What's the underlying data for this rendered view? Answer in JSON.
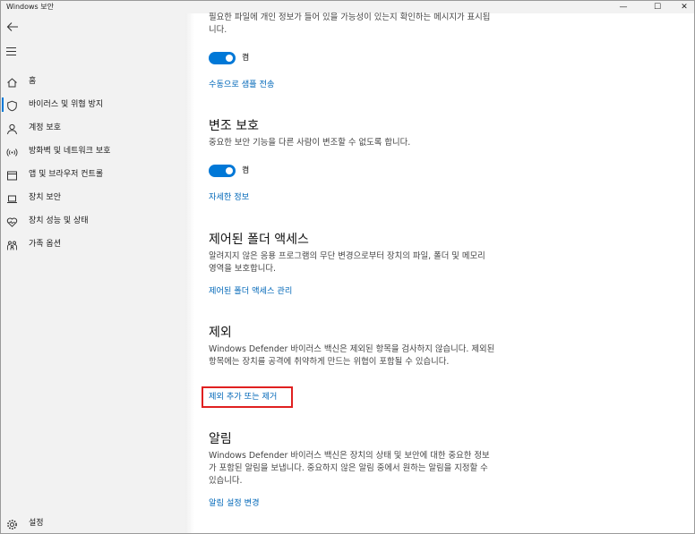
{
  "window": {
    "title": "Windows 보안",
    "min_glyph": "—",
    "max_glyph": "☐",
    "close_glyph": "✕"
  },
  "sidebar": {
    "back_icon": "back-arrow-icon",
    "menu_icon": "hamburger-menu-icon",
    "items": [
      {
        "label": "홈",
        "icon": "home-icon",
        "active": false
      },
      {
        "label": "바이러스 및 위협 방지",
        "icon": "shield-icon",
        "active": true
      },
      {
        "label": "계정 보호",
        "icon": "person-icon",
        "active": false
      },
      {
        "label": "방화벽 및 네트워크 보호",
        "icon": "wifi-icon",
        "active": false
      },
      {
        "label": "앱 및 브라우저 컨트롤",
        "icon": "app-window-icon",
        "active": false
      },
      {
        "label": "장치 보안",
        "icon": "laptop-icon",
        "active": false
      },
      {
        "label": "장치 성능 및 상태",
        "icon": "heart-icon",
        "active": false
      },
      {
        "label": "가족 옵션",
        "icon": "family-icon",
        "active": false
      }
    ],
    "settings": {
      "label": "설정",
      "icon": "gear-icon"
    }
  },
  "main": {
    "cloud_sample": {
      "desc": "필요한 파일에 개인 정보가 들어 있을 가능성이 있는지 확인하는 메시지가 표시됩니다.",
      "toggle_state": "켬",
      "link": "수동으로 샘플 전송"
    },
    "tamper": {
      "heading": "변조 보호",
      "desc": "중요한 보안 기능을 다른 사람이 변조할 수 없도록 합니다.",
      "toggle_state": "켬",
      "link": "자세한 정보"
    },
    "controlled_folder": {
      "heading": "제어된 폴더 액세스",
      "desc": "알려지지 않은 응용 프로그램의 무단 변경으로부터 장치의 파일, 폴더 및 메모리 영역을 보호합니다.",
      "link": "제어된 폴더 액세스 관리"
    },
    "exclusions": {
      "heading": "제외",
      "desc": "Windows Defender 바이러스 백신은 제외된 항목을 검사하지 않습니다. 제외된 항목에는 장치를 공격에 취약하게 만드는 위협이 포함될 수 있습니다.",
      "link": "제외 추가 또는 제거"
    },
    "notifications": {
      "heading": "알림",
      "desc": "Windows Defender 바이러스 백신은 장치의 상태 및 보안에 대한 중요한 정보가 포함된 알림을 보냅니다. 중요하지 않은 알림 중에서 원하는 알림을 지정할 수 있습니다.",
      "link": "알림 설정 변경"
    }
  },
  "colors": {
    "accent": "#0078d7",
    "link": "#0067b8",
    "highlight": "#e02020",
    "sidebar_bg": "#f2f2f2"
  }
}
